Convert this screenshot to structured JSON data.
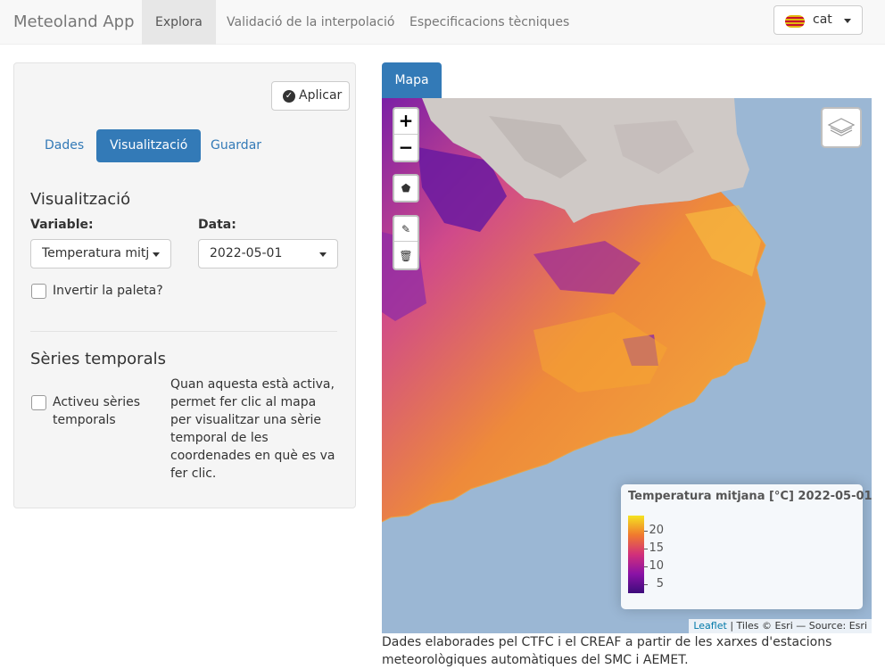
{
  "navbar": {
    "brand": "Meteoland App",
    "tabs": [
      {
        "label": "Explora",
        "active": true
      },
      {
        "label": "Validació de la interpolació",
        "active": false
      },
      {
        "label": "Especificacions tècniques",
        "active": false
      }
    ],
    "language": {
      "label": "cat",
      "icon": "catalan-flag-icon"
    }
  },
  "sidebar": {
    "apply_button": {
      "label": "Aplicar",
      "icon": "check-circle-icon"
    },
    "tabs": [
      {
        "label": "Dades",
        "active": false
      },
      {
        "label": "Visualització",
        "active": true
      },
      {
        "label": "Guardar",
        "active": false
      }
    ],
    "visualization": {
      "heading": "Visualització",
      "variable_label": "Variable:",
      "variable_value": "Temperatura mitjana",
      "date_label": "Data:",
      "date_value": "2022-05-01",
      "invert_palette_label": "Invertir la paleta?",
      "invert_palette_checked": false
    },
    "time_series": {
      "heading": "Sèries temporals",
      "activate_label": "Activeu sèries temporals",
      "activate_checked": false,
      "help_text": "Quan aquesta està activa, permet fer clic al mapa per visualitzar una sèrie temporal de les coordenades en què es va fer clic."
    }
  },
  "map": {
    "tab_label": "Mapa",
    "zoom_in": "+",
    "zoom_out": "−",
    "tools": [
      "draw-polygon-icon",
      "edit-icon",
      "trash-icon"
    ],
    "layers_icon": "layers-icon",
    "legend": {
      "title": "Temperatura mitjana [°C] 2022-05-01",
      "ticks": [
        "20",
        "15",
        "10",
        "5"
      ],
      "colors": [
        "#3d0c7b",
        "#8b12a6",
        "#d2307a",
        "#f07a2e",
        "#f5e320"
      ]
    },
    "attribution": {
      "leaflet": "Leaflet",
      "rest": "| Tiles © Esri — Source: Esri"
    }
  },
  "footer_note": "Dades elaborades pel CTFC i el CREAF a partir de les xarxes d'estacions meteorològiques automàtiques del SMC i AEMET."
}
